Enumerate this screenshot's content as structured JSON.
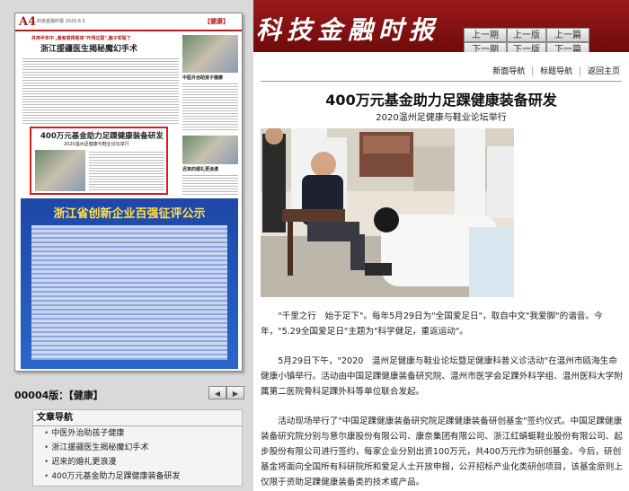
{
  "header": {
    "masthead": "科技金融时报",
    "nav": {
      "prev_page": "上一期",
      "next_page": "下一期",
      "prev_section": "上一版",
      "next_section": "下一版",
      "prev_article": "上一篇",
      "next_article": "下一篇"
    }
  },
  "paper_preview": {
    "page_number": "A4",
    "meta": "科技金融时报 2020.6.5",
    "section": "【健康】",
    "top_banner": "并用半年中 ,患者竟得愈来\"开颅过眉\",脑子却留了",
    "headline_1": "浙江援疆医生揭秘魔幻手术",
    "side_caption": "中医外治助孩子健康",
    "highlighted_title": "400万元基金助力足踝健康装备研发",
    "highlighted_subtitle": "2020温州足健康与鞋业论坛举行",
    "side_caption_2": "迟来的婚礼更浪漫",
    "ad_title": "浙江省创新企业百强征评公示"
  },
  "edition": {
    "label": "00004版：【健康】",
    "prev": "◀",
    "next": "▶"
  },
  "toc": {
    "title": "文章导航",
    "items": [
      "中医外治助孩子健康",
      "浙江援疆医生揭秘魔幻手术",
      "迟来的婚礼更浪漫",
      "400万元基金助力足踝健康装备研发"
    ]
  },
  "subnav": {
    "items": [
      "新面导航",
      "标题导航",
      "返回主页"
    ],
    "separator": "|"
  },
  "article": {
    "title": "400万元基金助力足踝健康装备研发",
    "subtitle": "2020温州足健康与鞋业论坛举行",
    "paragraphs": [
      "\"千里之行　始于足下\"。每年5月29日为\"全国爱足日\"，取自中文\"我爱脚\"的谐音。今年，\"5.29全国爱足日\"主题为\"科学健足，重返运动\"。",
      "5月29日下午，\"2020　温州足健康与鞋业论坛暨足健康科普义诊活动\"在温州市瓯海生命健康小镇举行。活动由中国足踝健康装备研究院、温州市医学会足踝外科学组、温州医科大学附属第二医院骨科足踝外科等单位联合发起。",
      "活动现场举行了\"中国足踝健康装备研究院足踝健康装备研创基金\"签约仪式。中国足踝健康装备研究院分别与意尔康股份有限公司、康奈集团有限公司、浙江红蜻蜓鞋业股份有限公司、起步股份有限公司进行签约，每家企业分别出资100万元，共400万元作为研创基金。今后，研创基金将面向全国所有科研院所和爱足人士开放申报，公开招标产业化类研创项目，该基金原则上仅限于资助足踝健康装备类的技术或产品。"
    ]
  }
}
